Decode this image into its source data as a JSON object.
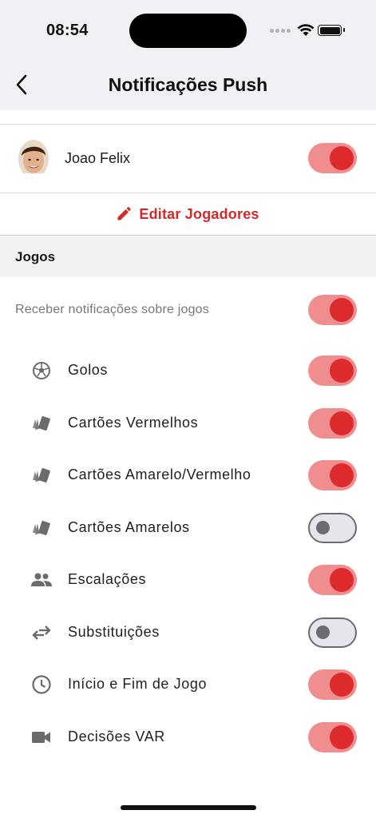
{
  "status_bar": {
    "time": "08:54"
  },
  "nav": {
    "title": "Notificações Push"
  },
  "player": {
    "name": "Joao Felix",
    "enabled": true
  },
  "edit_players": {
    "label": "Editar Jogadores"
  },
  "section": {
    "title": "Jogos"
  },
  "games_master": {
    "label": "Receber notificações sobre jogos",
    "enabled": true
  },
  "options": [
    {
      "icon": "soccer-ball-icon",
      "label": "Golos",
      "enabled": true
    },
    {
      "icon": "cards-icon",
      "label": "Cartões Vermelhos",
      "enabled": true
    },
    {
      "icon": "cards-icon",
      "label": "Cartões Amarelo/Vermelho",
      "enabled": true
    },
    {
      "icon": "cards-icon",
      "label": "Cartões Amarelos",
      "enabled": false
    },
    {
      "icon": "people-icon",
      "label": "Escalações",
      "enabled": true
    },
    {
      "icon": "swap-arrows-icon",
      "label": "Substituições",
      "enabled": false
    },
    {
      "icon": "clock-icon",
      "label": "Início e Fim de Jogo",
      "enabled": true
    },
    {
      "icon": "video-camera-icon",
      "label": "Decisões VAR",
      "enabled": true
    }
  ],
  "colors": {
    "accent": "#dc2a2d",
    "toggle_on_track": "#ef8d8f",
    "toggle_off_track": "#e8e4ec"
  }
}
